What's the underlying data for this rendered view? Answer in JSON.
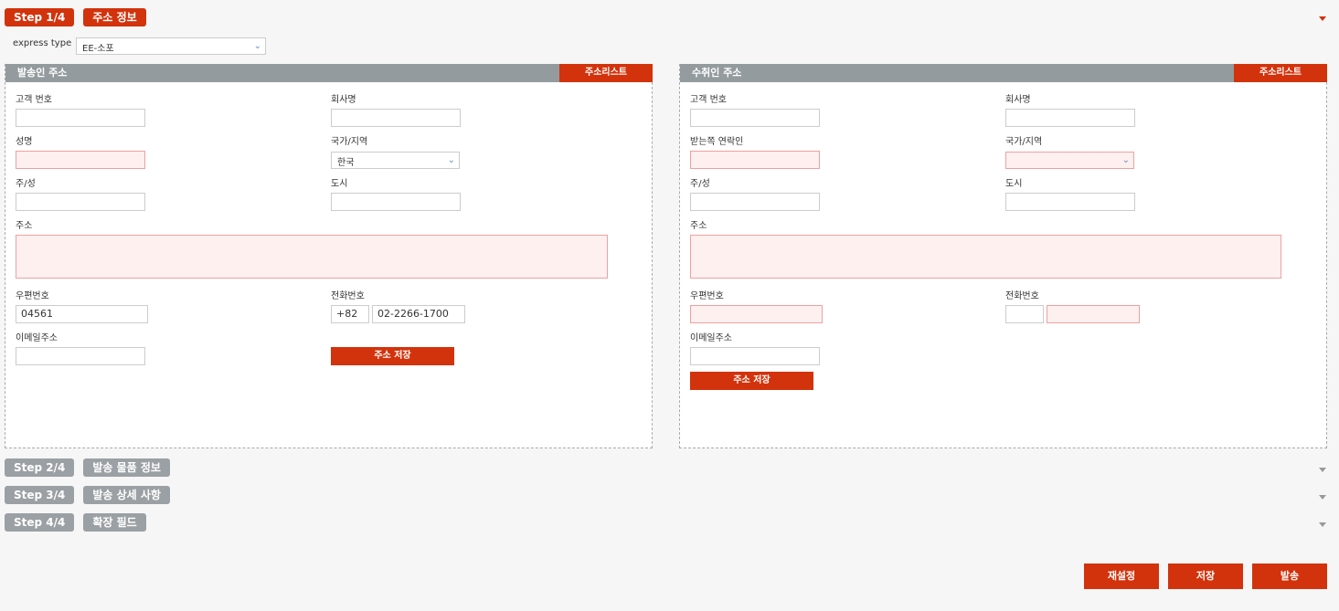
{
  "steps": [
    {
      "step": "Step 1/4",
      "title": "주소 정보"
    },
    {
      "step": "Step 2/4",
      "title": "발송 물품 정보"
    },
    {
      "step": "Step 3/4",
      "title": "발송 상세 사항"
    },
    {
      "step": "Step 4/4",
      "title": "확장 필드"
    }
  ],
  "express": {
    "label": "express type",
    "value": "EE-소포"
  },
  "sender": {
    "title": "발송인 주소",
    "address_list": "주소리스트",
    "customer_no": "고객 번호",
    "company": "회사명",
    "name": "성명",
    "country": "국가/지역",
    "country_value": "한국",
    "state": "주/성",
    "city": "도시",
    "address": "주소",
    "zip": "우편번호",
    "zip_value": "04561",
    "phone": "전화번호",
    "phone_code": "+82",
    "phone_value": "02-2266-1700",
    "email": "이메일주소",
    "save": "주소 저장"
  },
  "receiver": {
    "title": "수취인 주소",
    "address_list": "주소리스트",
    "customer_no": "고객 번호",
    "company": "회사명",
    "contact": "받는쪽 연락인",
    "country": "국가/지역",
    "country_value": "",
    "state": "주/성",
    "city": "도시",
    "address": "주소",
    "zip": "우편번호",
    "phone": "전화번호",
    "email": "이메일주소",
    "save": "주소 저장"
  },
  "actions": {
    "reset": "재설정",
    "save": "저장",
    "send": "발송"
  },
  "colors": {
    "accent": "#d2330c",
    "inactive": "#9aa0a3",
    "header": "#939b9e",
    "error_bg": "#fff0f0"
  }
}
